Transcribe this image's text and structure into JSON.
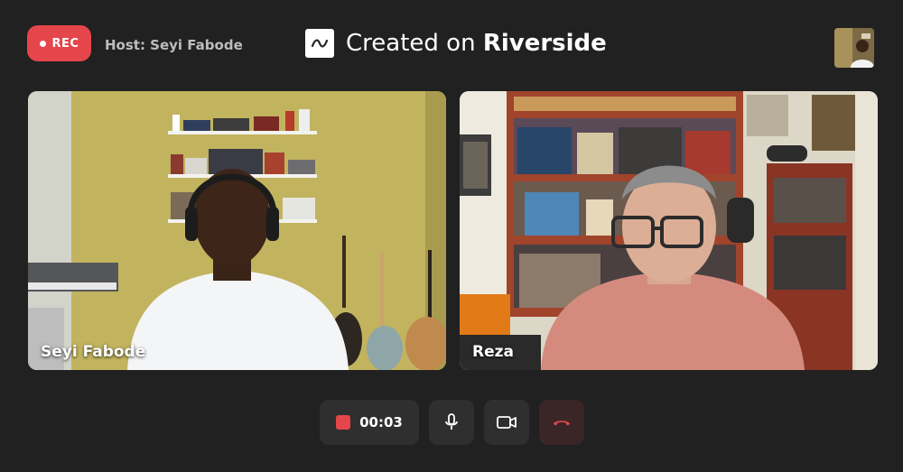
{
  "recording": {
    "label": "REC",
    "icon": "record-dot-icon",
    "color": "#e5464b"
  },
  "host": {
    "text": "Host: Seyi Fabode"
  },
  "brand": {
    "prefix": "Created on",
    "name": "Riverside",
    "icon": "riverside-wave-icon"
  },
  "self_view": {
    "icon": "self-view-thumbnail"
  },
  "participants": [
    {
      "name": "Seyi Fabode"
    },
    {
      "name": "Reza"
    }
  ],
  "controls": {
    "timer": "00:03",
    "stop_icon": "stop-recording-icon",
    "mic_icon": "microphone-icon",
    "camera_icon": "camera-icon",
    "end_icon": "end-call-icon",
    "end_color": "#e5464b"
  }
}
